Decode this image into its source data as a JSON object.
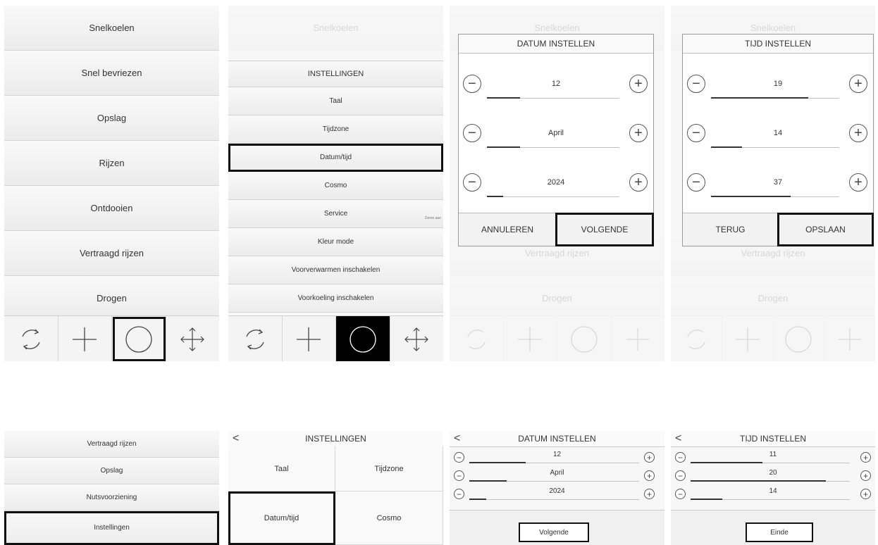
{
  "screen1": {
    "menu": [
      "Snelkoelen",
      "Snel bevriezen",
      "Opslag",
      "Rijzen",
      "Ontdooien",
      "Vertraagd rijzen",
      "Drogen"
    ],
    "toolbar_icons": [
      "refresh-icon",
      "plus-icon",
      "circle-icon",
      "move-icon"
    ]
  },
  "screen2": {
    "faded_top": "Snelkoelen",
    "header": "INSTELLINGEN",
    "menu": [
      "Taal",
      "Tijdzone",
      "Datum/tijd",
      "Cosmo",
      "Service",
      "Kleur mode",
      "Voorverwarmen inschakelen",
      "Voorkoeling inschakelen"
    ],
    "service_note": "Demo aan",
    "toolbar_icons": [
      "refresh-icon",
      "plus-icon",
      "circle-icon",
      "move-icon"
    ]
  },
  "screen3": {
    "bg_items": [
      "Snelkoelen",
      "Vertraagd rijzen",
      "Drogen"
    ],
    "title": "DATUM INSTELLEN",
    "rows": [
      {
        "value": "12",
        "fill": 0.25
      },
      {
        "value": "April",
        "fill": 0.25
      },
      {
        "value": "2024",
        "fill": 0.12
      }
    ],
    "cancel": "ANNULEREN",
    "next": "VOLGENDE"
  },
  "screen4": {
    "bg_items": [
      "Snelkoelen",
      "Vertraagd rijzen",
      "Drogen"
    ],
    "title": "TIJD INSTELLEN",
    "rows": [
      {
        "value": "19",
        "fill": 0.76
      },
      {
        "value": "14",
        "fill": 0.24
      },
      {
        "value": "37",
        "fill": 0.62
      }
    ],
    "back": "TERUG",
    "save": "OPSLAAN"
  },
  "screen5": {
    "menu": [
      "Vertraagd rijzen",
      "Opslag",
      "Nutsvoorziening",
      "Instellingen"
    ]
  },
  "screen6": {
    "title": "INSTELLINGEN",
    "back": "<",
    "cells": [
      "Taal",
      "Tijdzone",
      "Datum/tijd",
      "Cosmo"
    ]
  },
  "screen7": {
    "title": "DATUM INSTELLEN",
    "back": "<",
    "rows": [
      {
        "value": "12",
        "fill": 0.33
      },
      {
        "value": "April",
        "fill": 0.22
      },
      {
        "value": "2024",
        "fill": 0.1
      }
    ],
    "button": "Volgende"
  },
  "screen8": {
    "title": "TIJD INSTELLEN",
    "back": "<",
    "rows": [
      {
        "value": "11",
        "fill": 0.45
      },
      {
        "value": "20",
        "fill": 0.85
      },
      {
        "value": "14",
        "fill": 0.2
      }
    ],
    "button": "Einde"
  }
}
